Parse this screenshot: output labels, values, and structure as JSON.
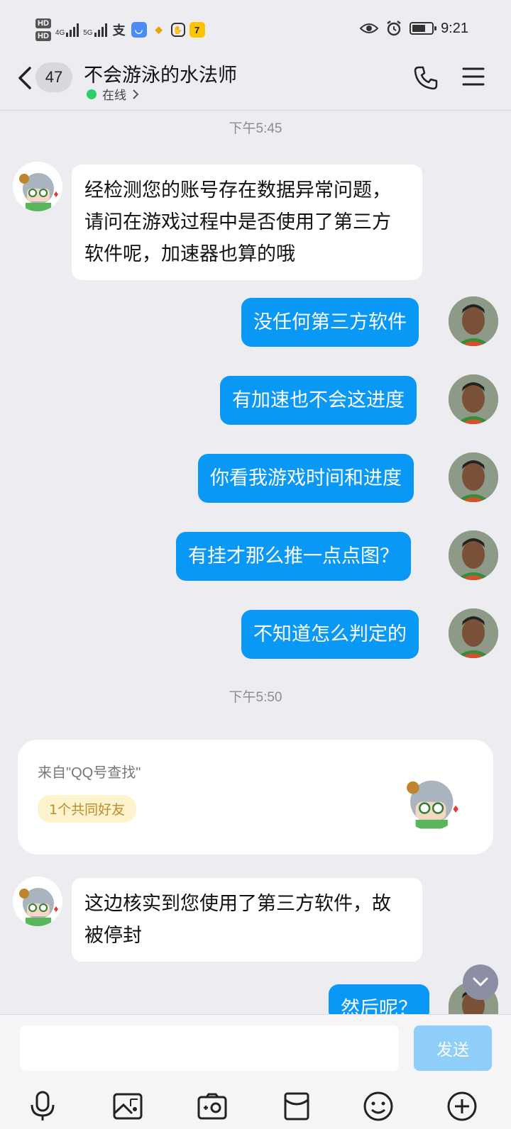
{
  "status": {
    "hd1": "HD",
    "hd2": "HD",
    "net1": "4G",
    "net2": "5G",
    "time": "9:21"
  },
  "header": {
    "unread": "47",
    "title": "不会游泳的水法师",
    "status": "在线"
  },
  "messages": {
    "t1": "下午5:45",
    "in1": "经检测您的账号存在数据异常问题，请问在游戏过程中是否使用了第三方软件呢，加速器也算的哦",
    "out1": "没任何第三方软件",
    "out2": "有加速也不会这进度",
    "out3": "你看我游戏时间和进度",
    "out4": "有挂才那么推一点点图？",
    "out5": "不知道怎么判定的",
    "t2": "下午5:50",
    "in2": "这边核实到您使用了第三方软件，故被停封",
    "out6": "然后呢？"
  },
  "card": {
    "source": "来自\"QQ号查找\"",
    "tag": "1个共同好友"
  },
  "input": {
    "placeholder": "",
    "send_label": "发送"
  },
  "colors": {
    "accent": "#0A98F7",
    "background": "#ECECF1",
    "online": "#2BD06B"
  }
}
